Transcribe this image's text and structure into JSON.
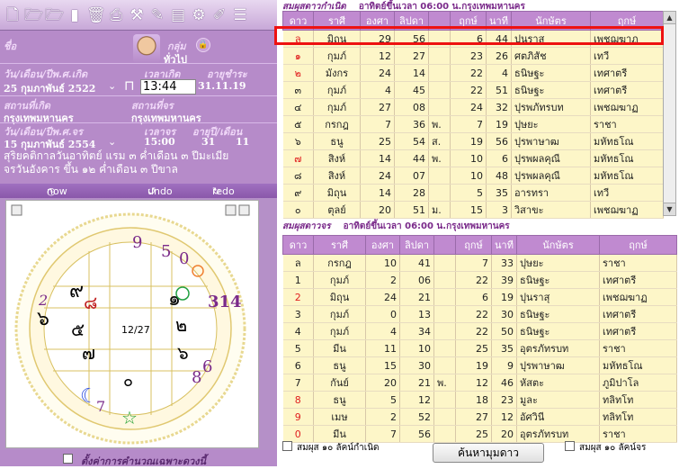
{
  "toolbar": {
    "icons": [
      "new-file-icon",
      "open-folder-icon",
      "open-folder-icon",
      "save-icon",
      "delete-icon",
      "print-icon",
      "tools-icon",
      "chart-edit-icon",
      "document-icon",
      "settings-icon",
      "pen-icon",
      "list-icon"
    ]
  },
  "person": {
    "name_label": "ชื่อ",
    "group_label": "กลุ่ม",
    "group_value": "ทั่วไป",
    "birth_date_label": "วัน/เดือน/ปีพ.ศ.เกิด",
    "birth_date_value": "25 กุมภาพันธ์ 2522",
    "birth_time_label": "เวลาเกิด",
    "birth_time_value": "13:44",
    "age_label": "อายุชำระ",
    "age_value": "31.11.19",
    "birth_place_label": "สถานที่เกิด",
    "birth_place_value": "กรุงเทพมหานคร",
    "current_place_label": "สถานที่จร",
    "current_place_value": "กรุงเทพมหานคร",
    "transit_date_label": "วัน/เดือน/ปีพ.ศ.จร",
    "transit_date_value": "15 กุมภาพันธ์ 2554",
    "transit_time_label": "เวลาจร",
    "transit_time_value": "15:00",
    "age_year_label": "อายุปี/เดือน",
    "age_year_value": "31",
    "age_month_value": "11",
    "lunar_line1": "สุริยคติกาลวันอาทิตย์ แรม ๓ ค่ำเดือน ๓ ปีมะเมีย",
    "lunar_line2": "จรวันอังคาร ขึ้น ๑๒ ค่ำเดือน ๓ ปีขาล"
  },
  "undo_bar": {
    "now": "now",
    "undo": "undo",
    "redo": "redo"
  },
  "chart_center": "12/27",
  "wheel_numbers": [
    "9",
    "5",
    "0",
    "314",
    "6",
    "8",
    "7",
    "2"
  ],
  "houses": [
    "๙",
    "๘",
    "๕",
    "๗",
    "๖",
    "๑",
    "๒",
    "๖",
    "๐"
  ],
  "bottom_label": "ตั้งค่าการคำนวณเฉพาะดวงนี้",
  "natal": {
    "title": "สมผุสดาวกำเนิด",
    "subtitle": "อาทิตย์ขึ้นเวลา 06:00 น.กรุงเทพมหานคร",
    "headers": [
      "ดาว",
      "ราศี",
      "องศา",
      "ลิปดา",
      "",
      "ฤกษ์",
      "นาที",
      "นักษัตร",
      "ฤกษ์"
    ],
    "rows": [
      [
        "ล",
        "มิถุน",
        "29",
        "56",
        "",
        "6",
        "44",
        "ปุนราสุ",
        "เพชฌฆาฏ"
      ],
      [
        "๑",
        "กุมภ์",
        "12",
        "27",
        "",
        "23",
        "26",
        "ศตภิสัช",
        "เทวี"
      ],
      [
        "๒",
        "มังกร",
        "24",
        "14",
        "",
        "22",
        "4",
        "ธนิษฐะ",
        "เทศาตรี"
      ],
      [
        "๓",
        "กุมภ์",
        "4",
        "45",
        "",
        "22",
        "51",
        "ธนิษฐะ",
        "เทศาตรี"
      ],
      [
        "๔",
        "กุมภ์",
        "27",
        "08",
        "",
        "24",
        "32",
        "ปุรพภัทรบท",
        "เพชฌฆาฏ"
      ],
      [
        "๕",
        "กรกฎ",
        "7",
        "36",
        "พ.",
        "7",
        "19",
        "ปุษยะ",
        "ราชา"
      ],
      [
        "๖",
        "ธนู",
        "25",
        "54",
        "ส.",
        "19",
        "56",
        "ปุรพาษาฒ",
        "มหัทธโณ"
      ],
      [
        "๗",
        "สิงห์",
        "14",
        "44",
        "พ.",
        "10",
        "6",
        "ปุรพผลคุณี",
        "มหัทธโณ"
      ],
      [
        "๘",
        "สิงห์",
        "24",
        "07",
        "",
        "10",
        "48",
        "ปุรพผลคุณี",
        "มหัทธโณ"
      ],
      [
        "๙",
        "มิถุน",
        "14",
        "28",
        "",
        "5",
        "35",
        "อารทรา",
        "เทวี"
      ],
      [
        "๐",
        "ตุลย์",
        "20",
        "51",
        "ม.",
        "15",
        "3",
        "วิสาขะ",
        "เพชฌฆาฏ"
      ]
    ],
    "red_rows": [
      0,
      1,
      2,
      7
    ]
  },
  "transit": {
    "title": "สมผุสดาวจร",
    "subtitle": "อาทิตย์ขึ้นเวลา 06:00 น.กรุงเทพมหานคร",
    "headers": [
      "ดาว",
      "ราศี",
      "องศา",
      "ลิปดา",
      "",
      "ฤกษ์",
      "นาที",
      "นักษัตร",
      "ฤกษ์"
    ],
    "rows": [
      [
        "ล",
        "กรกฎ",
        "10",
        "41",
        "",
        "7",
        "33",
        "ปุษยะ",
        "ราชา"
      ],
      [
        "1",
        "กุมภ์",
        "2",
        "06",
        "",
        "22",
        "39",
        "ธนิษฐะ",
        "เทศาตรี"
      ],
      [
        "2",
        "มิถุน",
        "24",
        "21",
        "",
        "6",
        "19",
        "ปุนราสุ",
        "เพชฌฆาฏ"
      ],
      [
        "3",
        "กุมภ์",
        "0",
        "13",
        "",
        "22",
        "30",
        "ธนิษฐะ",
        "เทศาตรี"
      ],
      [
        "4",
        "กุมภ์",
        "4",
        "34",
        "",
        "22",
        "50",
        "ธนิษฐะ",
        "เทศาตรี"
      ],
      [
        "5",
        "มีน",
        "11",
        "10",
        "",
        "25",
        "35",
        "อุตรภัทรบท",
        "ราชา"
      ],
      [
        "6",
        "ธนู",
        "15",
        "30",
        "",
        "19",
        "9",
        "ปุรพาษาฒ",
        "มหัทธโณ"
      ],
      [
        "7",
        "กันย์",
        "20",
        "21",
        "พ.",
        "12",
        "46",
        "หัสตะ",
        "ภูมิปาโล"
      ],
      [
        "8",
        "ธนู",
        "5",
        "12",
        "",
        "18",
        "23",
        "มูละ",
        "ทลิทโท"
      ],
      [
        "9",
        "เมษ",
        "2",
        "52",
        "",
        "27",
        "12",
        "อัศวินี",
        "ทลิทโท"
      ],
      [
        "0",
        "มีน",
        "7",
        "56",
        "",
        "25",
        "20",
        "อุตรภัทรบท",
        "ราชา"
      ]
    ],
    "red_rows": [
      2,
      8,
      9,
      10
    ]
  },
  "checkbox1_label": "สมผุส ๑๐ ลัคน์กำเนิด",
  "search_button": "ค้นหามุมดาว",
  "checkbox2_label": "สมผุส ๑๐ ลัคน์จร"
}
